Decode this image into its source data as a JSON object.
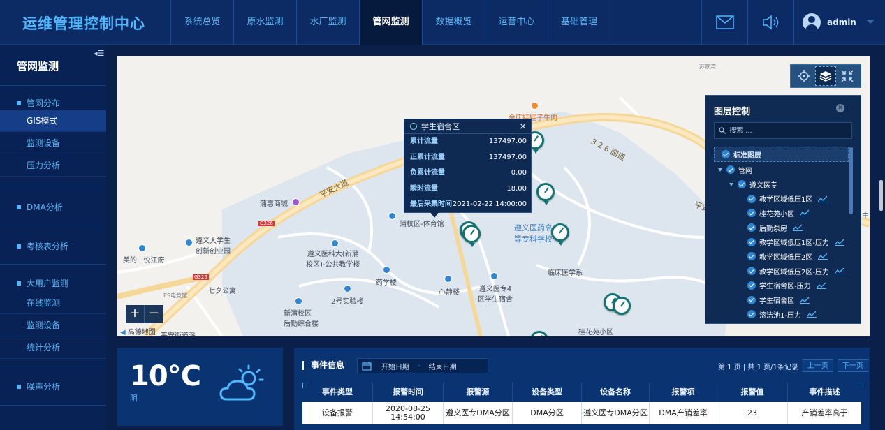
{
  "header": {
    "app_title": "运维管理控制中心",
    "nav": [
      "系统总览",
      "原水监测",
      "水厂监测",
      "管网监测",
      "数据概览",
      "运营中心",
      "基础管理"
    ],
    "active_nav": "管网监测",
    "user": "admin"
  },
  "sidebar": {
    "title": "管网监测",
    "groups": [
      {
        "label": "管网分布",
        "items": [
          "GIS模式",
          "监测设备",
          "压力分析"
        ]
      },
      {
        "label": "DMA分析",
        "items": []
      },
      {
        "label": "考核表分析",
        "items": []
      },
      {
        "label": "大用户监测",
        "items": [
          "在线监测",
          "监测设备",
          "统计分析"
        ]
      },
      {
        "label": "噪声分析",
        "items": []
      }
    ],
    "active_item": "GIS模式"
  },
  "map": {
    "labels": {
      "pingan_road": "平安大道",
      "g326_road": "3 2 6 国道",
      "pingan2": "平安",
      "zhong": "中",
      "sujiawan": "苏家湾",
      "jinqingwa": "金庆娃娃子牛肉",
      "puhui": "蒲惠商城",
      "g326_badge": "G326",
      "g326_badge2": "G326",
      "zunyi_univ": "遵义大学生\n创新创业园",
      "meide": "美的 · 悦江府",
      "esdian": "ES电竞馆",
      "qixing": "七夕公寓",
      "pushan_campus": "遵义医科大(新蒲\n校区)-公共教学楼",
      "puxiao_gym": "蒲校区-体育馆",
      "yaoxue": "药学楼",
      "shiyan2": "2号实验楼",
      "xinjing": "心静楼",
      "dorm4": "遵义医专4\n区学生宿舍",
      "linchuang": "临床医学系",
      "houqin": "新蒲校区\n后勤综合楼",
      "yaogao": "遵义医药高\n等专科学校",
      "guihua": "桂花苑小区",
      "pingan_street": "平安街道派",
      "logo": "高德地图"
    },
    "zoom_in": "+",
    "zoom_out": "−"
  },
  "popup": {
    "title": "学生宿舍区",
    "close": "×",
    "rows": [
      {
        "k": "累计流量",
        "v": "137497.00"
      },
      {
        "k": "正累计流量",
        "v": "137497.00"
      },
      {
        "k": "负累计流量",
        "v": "0.00"
      },
      {
        "k": "瞬时流量",
        "v": "18.00"
      },
      {
        "k": "最后采集时间",
        "v": "2021-02-22 14:00:00"
      }
    ]
  },
  "layer_control": {
    "title": "图层控制",
    "search_placeholder": "搜索 ...",
    "root": "标准图层",
    "node1": "管网",
    "node2": "遵义医专",
    "leaves": [
      "教学区域低压1区",
      "桂花苑小区",
      "后勤泵房",
      "教学区域低压1区-压力",
      "教学区域低压2区",
      "教学区域低压2区-压力",
      "学生宿舍区-压力",
      "学生宿舍区",
      "溶洁池1-压力"
    ]
  },
  "weather": {
    "temperature": "10℃",
    "condition": "阴"
  },
  "events": {
    "title": "事件信息",
    "start_date_placeholder": "开始日期",
    "date_sep": "-",
    "end_date_placeholder": "结束日期",
    "pager_text": "第 1 页 | 共 1 页/1条记录",
    "prev": "上一页",
    "next": "下一页",
    "columns": [
      "事件类型",
      "报警时间",
      "报警源",
      "设备类型",
      "设备名称",
      "报警项",
      "报警值",
      "事件描述"
    ],
    "rows": [
      [
        "设备报警",
        "2020-08-25 14:54:00",
        "遵义医专DMA分区",
        "DMA分区",
        "遵义医专DMA分区",
        "DMA产销差率",
        "23",
        "产销差率高于"
      ]
    ]
  },
  "colors": {
    "accent": "#4fb8ff",
    "header_bg": "#0c2a64",
    "panel_bg": "#0a3372",
    "meter": "#137272"
  }
}
